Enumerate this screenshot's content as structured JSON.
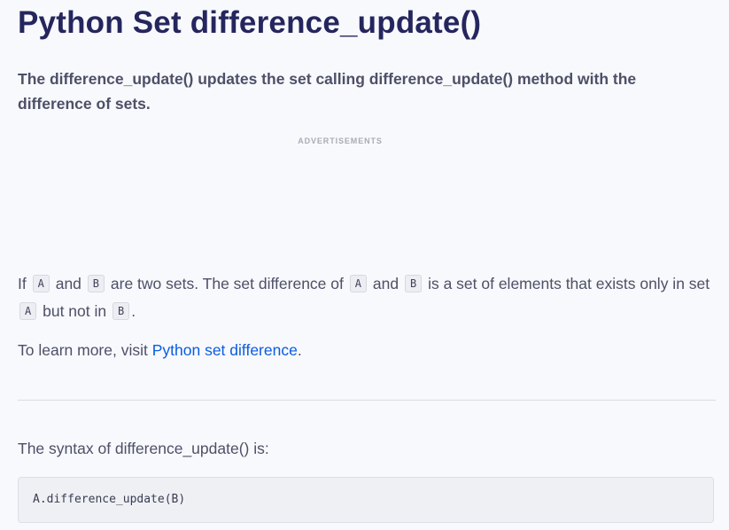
{
  "page_title": "Python Set difference_update()",
  "intro": "The difference_update() updates the set calling difference_update() method with the difference of sets.",
  "ad_label": "ADVERTISEMENTS",
  "para1": {
    "t1": "If",
    "c1": "A",
    "t2": "and",
    "c2": "B",
    "t3": "are two sets. The set difference of",
    "c3": "A",
    "t4": "and",
    "c4": "B",
    "t5": "is a set of elements that exists only in set",
    "c5": "A",
    "t6": "but not in",
    "c6": "B",
    "t7": "."
  },
  "para2": {
    "prefix": "To learn more, visit",
    "link_text": "Python set difference",
    "suffix": "."
  },
  "syntax_intro": "The syntax of difference_update() is:",
  "syntax_code": "A.difference_update(B)"
}
